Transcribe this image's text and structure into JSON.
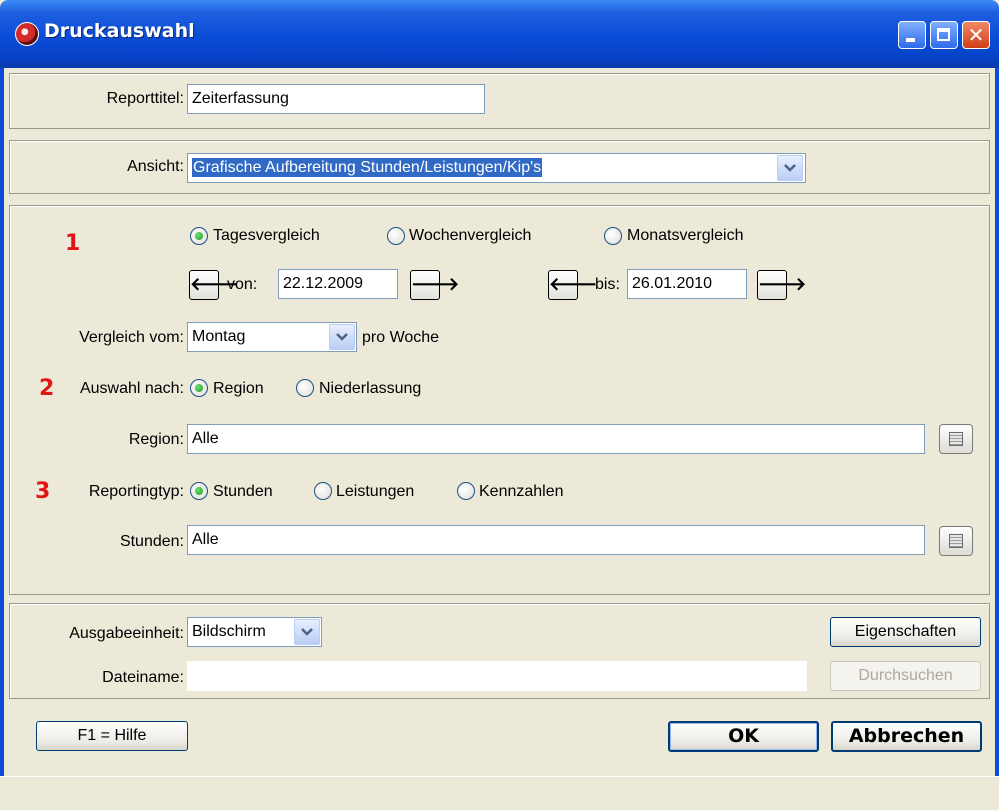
{
  "window": {
    "title": "Druckauswahl",
    "accent_color": "#0a4cd6",
    "icon": "app-shield-icon"
  },
  "report": {
    "title_label": "Reporttitel:",
    "title_value": "Zeiterfassung"
  },
  "ansicht": {
    "label": "Ansicht:",
    "value": "Grafische Aufbereitung Stunden/Leistungen/Kip's"
  },
  "section1": {
    "marker": "1",
    "compare_options": [
      "Tagesvergleich",
      "Wochenvergleich",
      "Monatsvergleich"
    ],
    "selected_compare": "Tagesvergleich",
    "von_label": "von:",
    "von_value": "22.12.2009",
    "bis_label": "bis:",
    "bis_value": "26.01.2010",
    "vergleich_label": "Vergleich vom:",
    "vergleich_value": "Montag",
    "pro_woche": "pro Woche"
  },
  "section2": {
    "marker": "2",
    "label": "Auswahl nach:",
    "options": [
      "Region",
      "Niederlassung"
    ],
    "selected": "Region",
    "region_label": "Region:",
    "region_value": "Alle"
  },
  "section3": {
    "marker": "3",
    "label": "Reportingtyp:",
    "options": [
      "Stunden",
      "Leistungen",
      "Kennzahlen"
    ],
    "selected": "Stunden",
    "stunden_label": "Stunden:",
    "stunden_value": "Alle"
  },
  "output": {
    "ausgabe_label": "Ausgabeeinheit:",
    "ausgabe_value": "Bildschirm",
    "eigenschaften_label": "Eigenschaften",
    "dateiname_label": "Dateiname:",
    "dateiname_value": "",
    "durchsuchen_label": "Durchsuchen"
  },
  "footer": {
    "help_label": "F1 = Hilfe",
    "ok_label": "OK",
    "cancel_label": "Abbrechen"
  },
  "marker_color": "#e01414"
}
